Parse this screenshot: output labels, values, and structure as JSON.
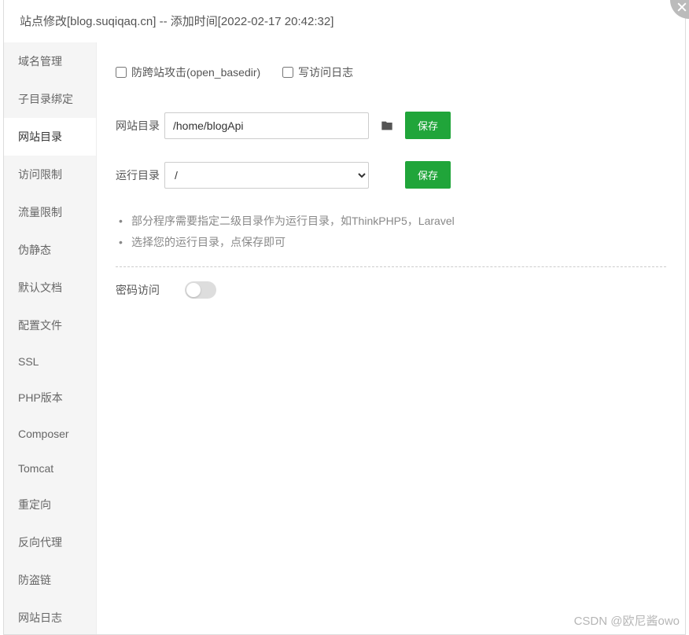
{
  "header": {
    "title": "站点修改[blog.suqiqaq.cn] -- 添加时间[2022-02-17 20:42:32]"
  },
  "sidebar": {
    "items": [
      {
        "label": "域名管理"
      },
      {
        "label": "子目录绑定"
      },
      {
        "label": "网站目录"
      },
      {
        "label": "访问限制"
      },
      {
        "label": "流量限制"
      },
      {
        "label": "伪静态"
      },
      {
        "label": "默认文档"
      },
      {
        "label": "配置文件"
      },
      {
        "label": "SSL"
      },
      {
        "label": "PHP版本"
      },
      {
        "label": "Composer"
      },
      {
        "label": "Tomcat"
      },
      {
        "label": "重定向"
      },
      {
        "label": "反向代理"
      },
      {
        "label": "防盗链"
      },
      {
        "label": "网站日志"
      }
    ],
    "active_index": 2
  },
  "content": {
    "checkbox1_label": "防跨站攻击(open_basedir)",
    "checkbox2_label": "写访问日志",
    "site_dir_label": "网站目录",
    "site_dir_value": "/home/blogApi",
    "run_dir_label": "运行目录",
    "run_dir_value": "/",
    "save_label": "保存",
    "hints": [
      "部分程序需要指定二级目录作为运行目录，如ThinkPHP5，Laravel",
      "选择您的运行目录，点保存即可"
    ],
    "password_access_label": "密码访问"
  },
  "watermark": "CSDN @欧尼酱owo"
}
